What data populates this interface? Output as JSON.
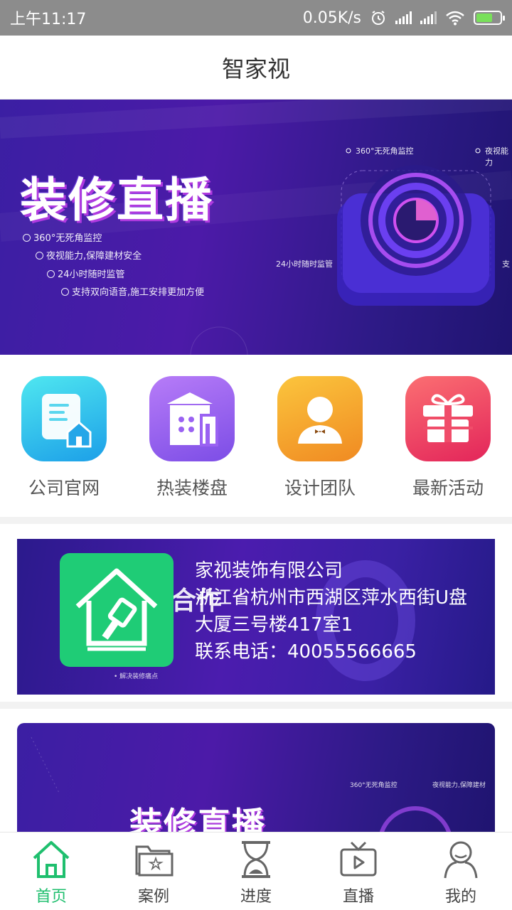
{
  "status_bar": {
    "time": "上午11:17",
    "network_speed": "0.05K/s"
  },
  "header": {
    "title": "智家视"
  },
  "banner": {
    "title": "装修直播",
    "features": [
      "360°无死角监控",
      "夜视能力,保障建材安全",
      "24小时随时监管",
      "支持双向语音,施工安排更加方便"
    ],
    "device_labels": [
      "360°无死角监控",
      "夜视能力",
      "24小时随时监管",
      "支"
    ],
    "slides": 3,
    "active_slide": 2
  },
  "quick_menu": [
    {
      "label": "公司官网",
      "icon": "website-document-icon"
    },
    {
      "label": "热装楼盘",
      "icon": "building-icon"
    },
    {
      "label": "设计团队",
      "icon": "designer-person-icon"
    },
    {
      "label": "最新活动",
      "icon": "gift-icon"
    }
  ],
  "company": {
    "name": "家视装饰有限公司",
    "address": "浙江省杭州市西湖区萍水西街U盘大厦三号楼417室1",
    "phone": "联系电话：40055566665",
    "bg_text": "合作",
    "note": "• 解决装修痛点"
  },
  "banner2": {
    "title": "装修直播",
    "labels": [
      "360°无死角监控",
      "夜视能力,保障建材"
    ]
  },
  "bottom_nav": [
    {
      "label": "首页",
      "icon": "home-icon",
      "active": true
    },
    {
      "label": "案例",
      "icon": "folder-star-icon",
      "active": false
    },
    {
      "label": "进度",
      "icon": "hourglass-icon",
      "active": false
    },
    {
      "label": "直播",
      "icon": "tv-play-icon",
      "active": false
    },
    {
      "label": "我的",
      "icon": "profile-icon",
      "active": false
    }
  ],
  "colors": {
    "accent_green": "#1fbf6e",
    "banner_purple": "#4c1aa8",
    "status_bar": "#8c8c8c"
  }
}
